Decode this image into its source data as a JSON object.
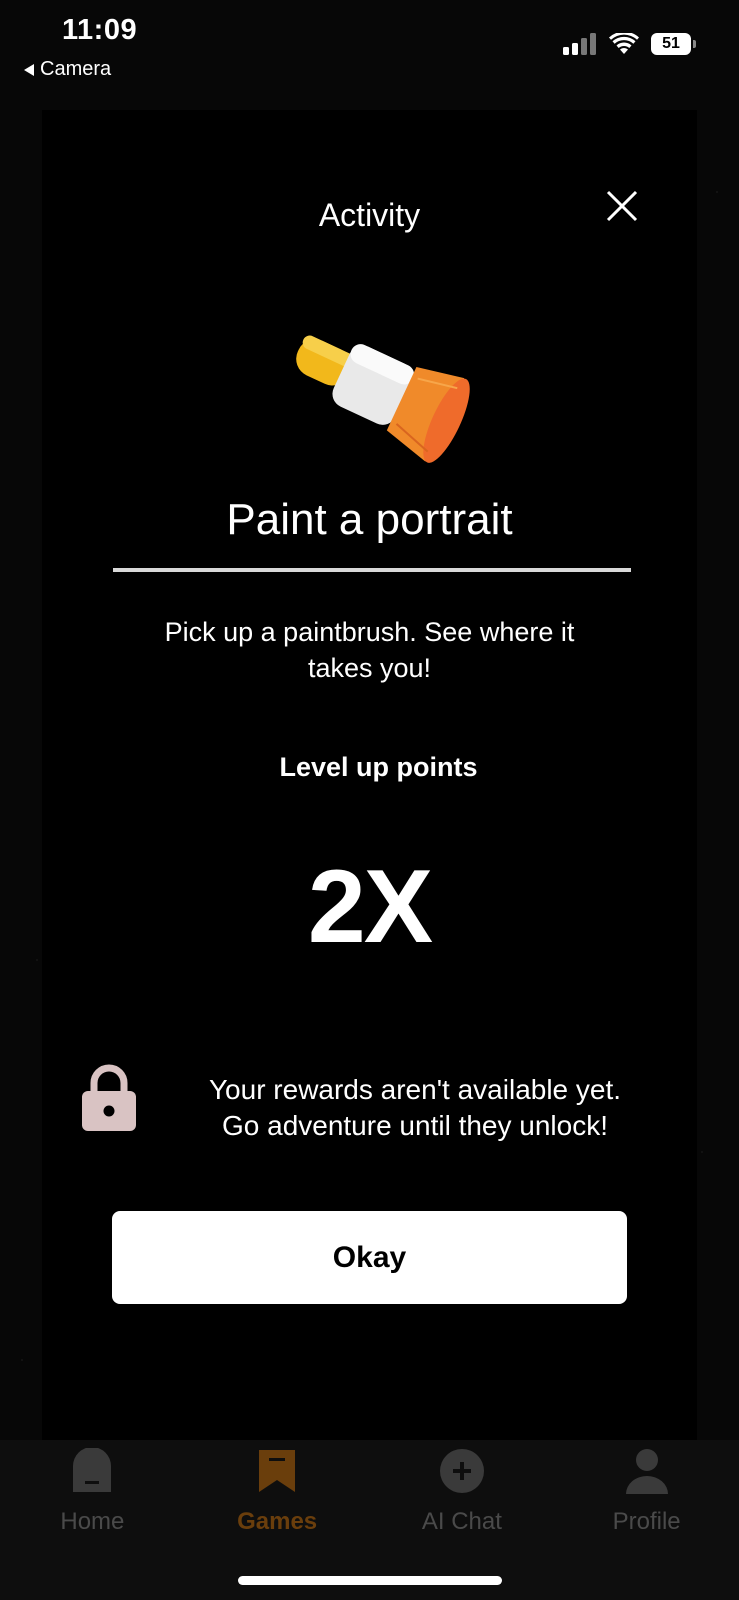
{
  "status_bar": {
    "time": "11:09",
    "back_label": "Camera",
    "battery": "51"
  },
  "modal": {
    "title": "Activity",
    "activity_name": "Paint a portrait",
    "description": "Pick up a paintbrush. See where it takes you!",
    "points_label": "Level up points",
    "multiplier": "2X",
    "locked_message_line1": "Your rewards aren't available yet.",
    "locked_message_line2": "Go adventure until they unlock!",
    "okay_label": "Okay",
    "icons": {
      "close": "close-icon",
      "brush": "paintbrush-icon",
      "lock": "lock-icon"
    }
  },
  "tabbar": {
    "active": "Games",
    "items": [
      {
        "label": "Home",
        "icon": "home-icon"
      },
      {
        "label": "Games",
        "icon": "bookmark-icon"
      },
      {
        "label": "AI Chat",
        "icon": "plus-circle-icon"
      },
      {
        "label": "Profile",
        "icon": "person-icon"
      }
    ]
  },
  "colors": {
    "active_tab": "#6a3e0c",
    "button_bg": "#ffffff",
    "lock": "#d9c3c3"
  }
}
